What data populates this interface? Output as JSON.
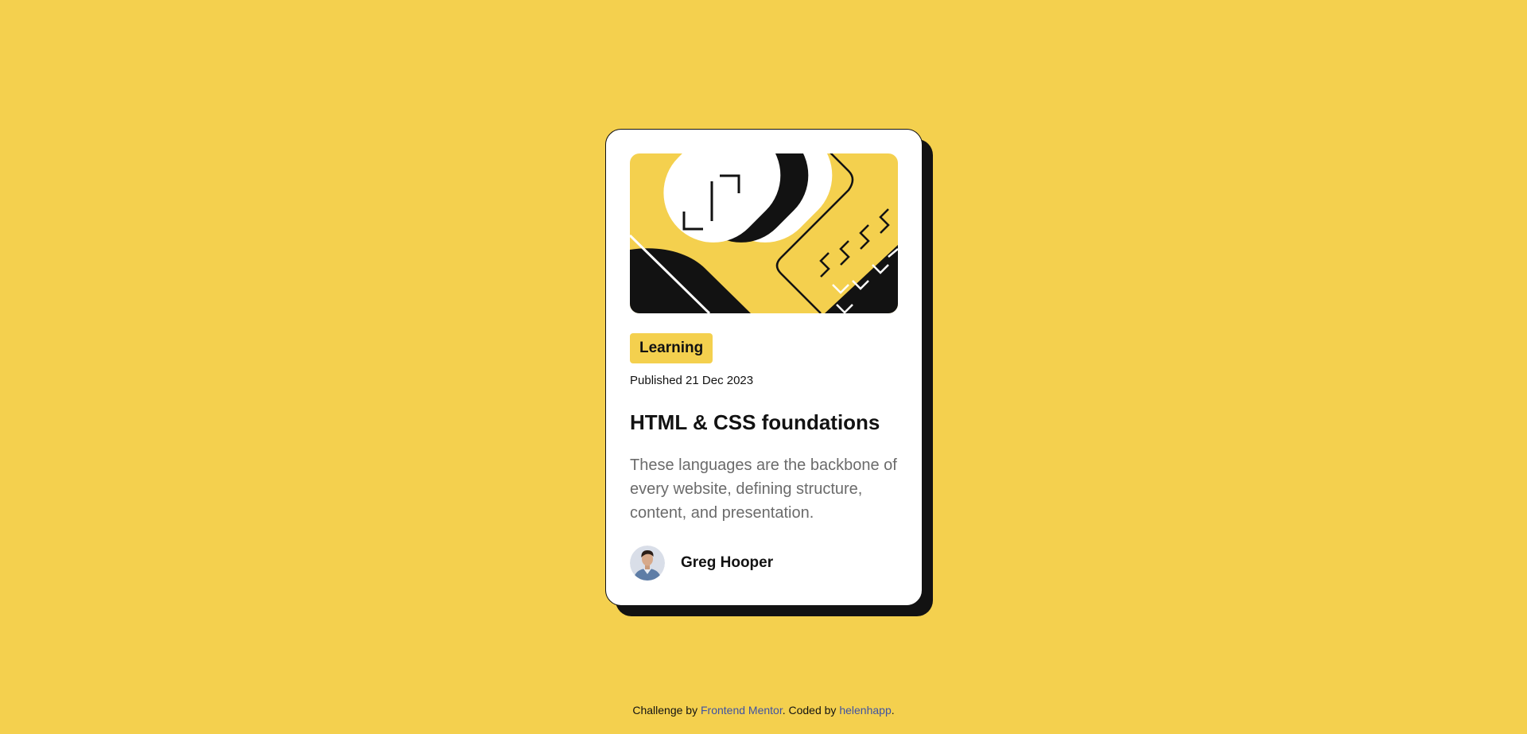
{
  "colors": {
    "background": "#F4D04E",
    "card": "#FFFFFF",
    "ink": "#121212",
    "muted": "#6B6B6B",
    "link": "#3E52A3"
  },
  "card": {
    "hero_image": "illustration-article",
    "tag": "Learning",
    "published": "Published 21 Dec 2023",
    "title": "HTML & CSS foundations",
    "description": "These languages are the backbone of every website, defining structure, content, and presentation.",
    "author": {
      "avatar": "avatar-image",
      "name": "Greg Hooper"
    }
  },
  "attribution": {
    "prefix": "Challenge by ",
    "link1": "Frontend Mentor",
    "middle": ". Coded by ",
    "link2": "helenhapp",
    "suffix": "."
  }
}
